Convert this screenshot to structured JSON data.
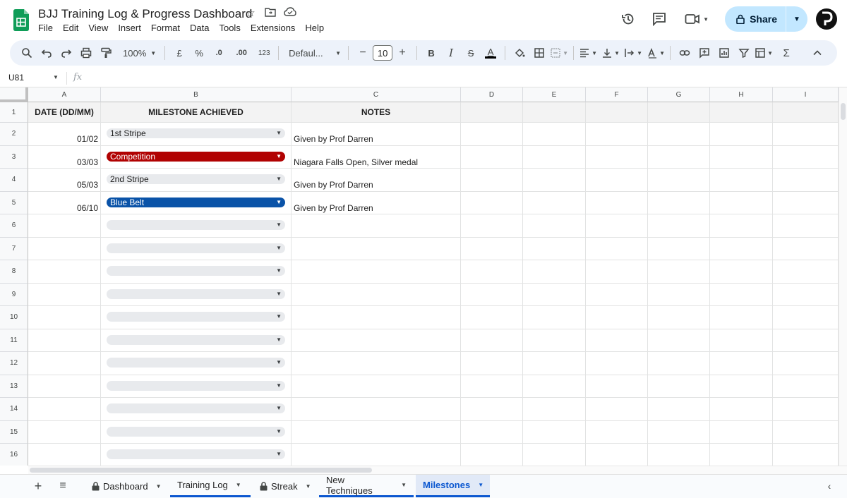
{
  "doc": {
    "title": "BJJ Training Log & Progress Dashboard"
  },
  "menu": [
    "File",
    "Edit",
    "View",
    "Insert",
    "Format",
    "Data",
    "Tools",
    "Extensions",
    "Help"
  ],
  "share": {
    "label": "Share"
  },
  "toolbar": {
    "zoom": "100%",
    "currency": "£",
    "percent": "%",
    "dec_less": ".0",
    "dec_more": ".00",
    "number_format": "123",
    "font": "Defaul...",
    "font_size": "10",
    "bold": "B",
    "italic": "I",
    "strike": "S",
    "text_color": "A"
  },
  "formula_bar": {
    "cell_ref": "U81",
    "fx": "fx"
  },
  "columns": [
    "A",
    "B",
    "C",
    "D",
    "E",
    "F",
    "G",
    "H",
    "I"
  ],
  "rows": [
    "1",
    "2",
    "3",
    "4",
    "5",
    "6",
    "7",
    "8",
    "9",
    "10",
    "11",
    "12",
    "13",
    "14",
    "15",
    "16"
  ],
  "header": {
    "date": "DATE (DD/MM)",
    "milestone": "MILESTONE ACHIEVED",
    "notes": "NOTES"
  },
  "entries": [
    {
      "date": "01/02",
      "milestone": "1st Stripe",
      "notes": "Given by Prof Darren",
      "chip_color": "#e8eaed"
    },
    {
      "date": "03/03",
      "milestone": "Competition",
      "notes": "Niagara Falls Open, Silver medal",
      "chip_color": "#b10202"
    },
    {
      "date": "05/03",
      "milestone": "2nd Stripe",
      "notes": "Given by Prof Darren",
      "chip_color": "#e8eaed"
    },
    {
      "date": "06/10",
      "milestone": "Blue Belt",
      "notes": "Given by Prof Darren",
      "chip_color": "#0a53a8"
    }
  ],
  "tabs": [
    {
      "label": "Dashboard",
      "locked": true
    },
    {
      "label": "Training Log",
      "locked": false
    },
    {
      "label": "Streak",
      "locked": true
    },
    {
      "label": "New Techniques",
      "locked": false
    },
    {
      "label": "Milestones",
      "locked": false,
      "active": true
    }
  ]
}
